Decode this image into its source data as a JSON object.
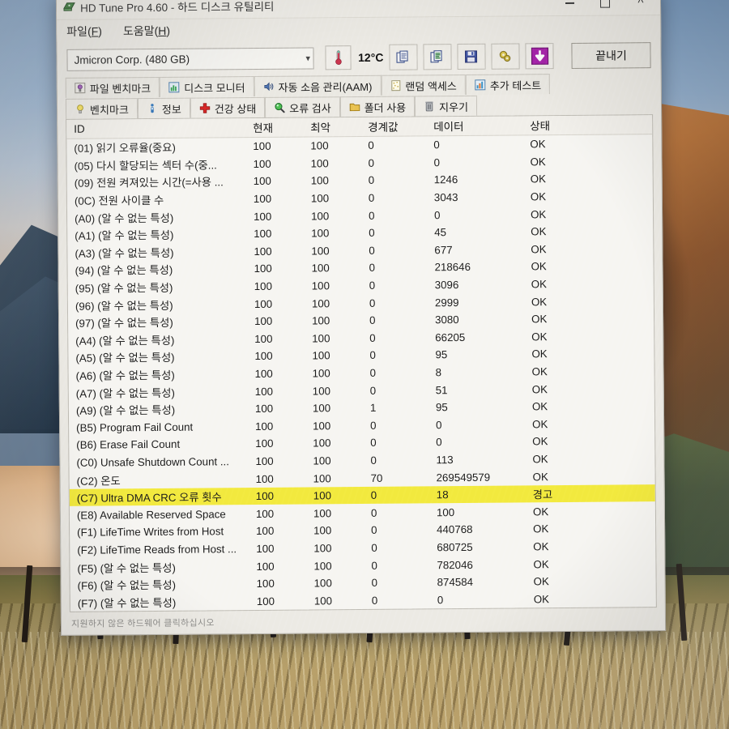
{
  "window": {
    "title": "HD Tune Pro 4.60 - 하드 디스크 유틸리티",
    "icon": "hdd-icon",
    "controls": {
      "minimize": "minimize-icon",
      "maximize": "maximize-icon",
      "close": "close-icon"
    }
  },
  "menu": {
    "items": [
      {
        "label": "파일",
        "accel": "F"
      },
      {
        "label": "도움말",
        "accel": "H"
      }
    ]
  },
  "toolbar": {
    "drive": {
      "value": "Jmicron Corp. (480 GB)",
      "arrow": "chevron-down-icon"
    },
    "temperature": {
      "icon": "thermometer-icon",
      "value": "12°C"
    },
    "buttons": [
      {
        "name": "copy-screenshot-button",
        "icon": "copy-icon"
      },
      {
        "name": "copy-text-button",
        "icon": "copy-text-icon"
      },
      {
        "name": "save-button",
        "icon": "floppy-disk-icon"
      },
      {
        "name": "settings-button",
        "icon": "gears-icon"
      },
      {
        "name": "download-button",
        "icon": "down-arrow-icon"
      }
    ],
    "exit_label": "끝내기"
  },
  "tabs": {
    "row1": [
      {
        "label": "파일 벤치마크",
        "icon": "file-benchmark-icon",
        "active": false
      },
      {
        "label": "디스크 모니터",
        "icon": "disk-monitor-icon",
        "active": false
      },
      {
        "label": "자동 소음 관리(AAM)",
        "icon": "speaker-icon",
        "active": false
      },
      {
        "label": "랜덤 액세스",
        "icon": "random-access-icon",
        "active": false
      },
      {
        "label": "추가 테스트",
        "icon": "extra-test-icon",
        "active": false
      }
    ],
    "row2": [
      {
        "label": "벤치마크",
        "icon": "lightbulb-icon",
        "active": false
      },
      {
        "label": "정보",
        "icon": "info-icon",
        "active": false
      },
      {
        "label": "건강 상태",
        "icon": "red-cross-icon",
        "active": true
      },
      {
        "label": "오류 검사",
        "icon": "magnifier-icon",
        "active": false
      },
      {
        "label": "폴더 사용",
        "icon": "folder-icon",
        "active": false
      },
      {
        "label": "지우기",
        "icon": "trash-icon",
        "active": false
      }
    ]
  },
  "grid": {
    "columns": [
      "ID",
      "현재",
      "최악",
      "경계값",
      "데이터",
      "상태"
    ],
    "rows": [
      {
        "id": "(01) 읽기 오류율(중요)",
        "current": "100",
        "worst": "100",
        "threshold": "0",
        "data": "0",
        "status": "OK",
        "warn": false
      },
      {
        "id": "(05) 다시 할당되는 섹터 수(중...",
        "current": "100",
        "worst": "100",
        "threshold": "0",
        "data": "0",
        "status": "OK",
        "warn": false
      },
      {
        "id": "(09) 전원 켜져있는 시간(=사용 ...",
        "current": "100",
        "worst": "100",
        "threshold": "0",
        "data": "1246",
        "status": "OK",
        "warn": false
      },
      {
        "id": "(0C) 전원 사이클 수",
        "current": "100",
        "worst": "100",
        "threshold": "0",
        "data": "3043",
        "status": "OK",
        "warn": false
      },
      {
        "id": "(A0) (알 수 없는 특성)",
        "current": "100",
        "worst": "100",
        "threshold": "0",
        "data": "0",
        "status": "OK",
        "warn": false
      },
      {
        "id": "(A1) (알 수 없는 특성)",
        "current": "100",
        "worst": "100",
        "threshold": "0",
        "data": "45",
        "status": "OK",
        "warn": false
      },
      {
        "id": "(A3) (알 수 없는 특성)",
        "current": "100",
        "worst": "100",
        "threshold": "0",
        "data": "677",
        "status": "OK",
        "warn": false
      },
      {
        "id": "(94) (알 수 없는 특성)",
        "current": "100",
        "worst": "100",
        "threshold": "0",
        "data": "218646",
        "status": "OK",
        "warn": false
      },
      {
        "id": "(95) (알 수 없는 특성)",
        "current": "100",
        "worst": "100",
        "threshold": "0",
        "data": "3096",
        "status": "OK",
        "warn": false
      },
      {
        "id": "(96) (알 수 없는 특성)",
        "current": "100",
        "worst": "100",
        "threshold": "0",
        "data": "2999",
        "status": "OK",
        "warn": false
      },
      {
        "id": "(97) (알 수 없는 특성)",
        "current": "100",
        "worst": "100",
        "threshold": "0",
        "data": "3080",
        "status": "OK",
        "warn": false
      },
      {
        "id": "(A4) (알 수 없는 특성)",
        "current": "100",
        "worst": "100",
        "threshold": "0",
        "data": "66205",
        "status": "OK",
        "warn": false
      },
      {
        "id": "(A5) (알 수 없는 특성)",
        "current": "100",
        "worst": "100",
        "threshold": "0",
        "data": "95",
        "status": "OK",
        "warn": false
      },
      {
        "id": "(A6) (알 수 없는 특성)",
        "current": "100",
        "worst": "100",
        "threshold": "0",
        "data": "8",
        "status": "OK",
        "warn": false
      },
      {
        "id": "(A7) (알 수 없는 특성)",
        "current": "100",
        "worst": "100",
        "threshold": "0",
        "data": "51",
        "status": "OK",
        "warn": false
      },
      {
        "id": "(A9) (알 수 없는 특성)",
        "current": "100",
        "worst": "100",
        "threshold": "1",
        "data": "95",
        "status": "OK",
        "warn": false
      },
      {
        "id": "(B5) Program Fail Count",
        "current": "100",
        "worst": "100",
        "threshold": "0",
        "data": "0",
        "status": "OK",
        "warn": false
      },
      {
        "id": "(B6) Erase Fail Count",
        "current": "100",
        "worst": "100",
        "threshold": "0",
        "data": "0",
        "status": "OK",
        "warn": false
      },
      {
        "id": "(C0) Unsafe Shutdown Count  ...",
        "current": "100",
        "worst": "100",
        "threshold": "0",
        "data": "113",
        "status": "OK",
        "warn": false
      },
      {
        "id": "(C2) 온도",
        "current": "100",
        "worst": "100",
        "threshold": "70",
        "data": "269549579",
        "status": "OK",
        "warn": false
      },
      {
        "id": "(C7) Ultra DMA CRC 오류 횟수",
        "current": "100",
        "worst": "100",
        "threshold": "0",
        "data": "18",
        "status": "경고",
        "warn": true
      },
      {
        "id": "(E8) Available Reserved Space",
        "current": "100",
        "worst": "100",
        "threshold": "0",
        "data": "100",
        "status": "OK",
        "warn": false
      },
      {
        "id": "(F1) LifeTime Writes from Host",
        "current": "100",
        "worst": "100",
        "threshold": "0",
        "data": "440768",
        "status": "OK",
        "warn": false
      },
      {
        "id": "(F2) LifeTime Reads from Host  ...",
        "current": "100",
        "worst": "100",
        "threshold": "0",
        "data": "680725",
        "status": "OK",
        "warn": false
      },
      {
        "id": "(F5) (알 수 없는 특성)",
        "current": "100",
        "worst": "100",
        "threshold": "0",
        "data": "782046",
        "status": "OK",
        "warn": false
      },
      {
        "id": "(F6) (알 수 없는 특성)",
        "current": "100",
        "worst": "100",
        "threshold": "0",
        "data": "874584",
        "status": "OK",
        "warn": false
      },
      {
        "id": "(F7) (알 수 없는 특성)",
        "current": "100",
        "worst": "100",
        "threshold": "0",
        "data": "0",
        "status": "OK",
        "warn": false
      }
    ]
  },
  "statusbar": {
    "text": "지원하지 않은 하드웨어 클릭하십시오",
    "right": ""
  },
  "colors": {
    "warn_highlight": "#f2e93c",
    "window_bg": "#eceae4",
    "grid_bg": "#f6f5f1",
    "accent_purple": "#a424a8",
    "accent_red": "#cc2222"
  }
}
